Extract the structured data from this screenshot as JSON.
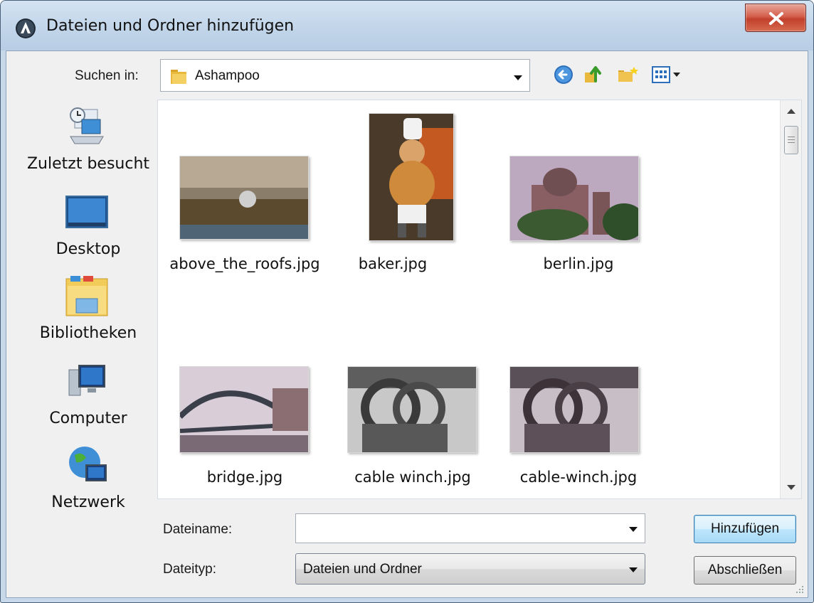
{
  "window": {
    "title": "Dateien und Ordner hinzufügen",
    "close_glyph": "x"
  },
  "toolbar": {
    "look_in_label": "Suchen in:",
    "look_in_value": "Ashampoo",
    "icons": [
      "back-icon",
      "up-folder-icon",
      "new-folder-icon",
      "view-menu-icon"
    ]
  },
  "places": [
    {
      "label": "Zuletzt besucht",
      "icon": "recent-places-icon"
    },
    {
      "label": "Desktop",
      "icon": "desktop-icon"
    },
    {
      "label": "Bibliotheken",
      "icon": "libraries-icon"
    },
    {
      "label": "Computer",
      "icon": "computer-icon"
    },
    {
      "label": "Netzwerk",
      "icon": "network-icon"
    }
  ],
  "files": [
    {
      "name": "above_the_roofs.jpg"
    },
    {
      "name": "baker.jpg"
    },
    {
      "name": "berlin.jpg"
    },
    {
      "name": "bridge.jpg"
    },
    {
      "name": "cable winch.jpg"
    },
    {
      "name": "cable-winch.jpg"
    }
  ],
  "form": {
    "filename_label": "Dateiname:",
    "filename_value": "",
    "filetype_label": "Dateityp:",
    "filetype_value": "Dateien und Ordner"
  },
  "buttons": {
    "add": "Hinzufügen",
    "close": "Abschließen"
  },
  "colors": {
    "accent_blue": "#3c7fb1",
    "close_red": "#c2402b"
  }
}
